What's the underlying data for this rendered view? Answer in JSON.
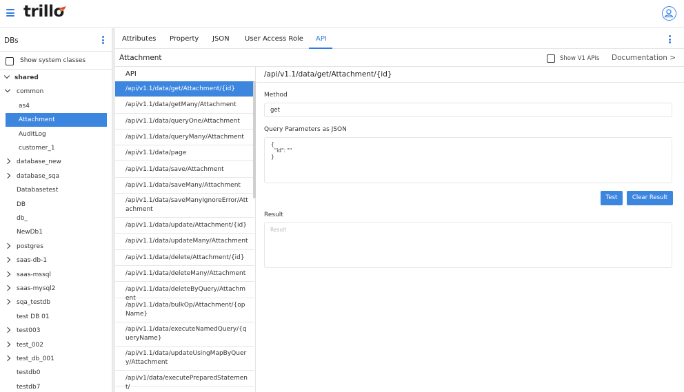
{
  "app": {
    "logo_text": "trillo",
    "accent": "#2f7be0",
    "selected_bg": "#3d86e0"
  },
  "topbar": {
    "menu_icon": "hamburger-icon",
    "user_icon": "user-avatar-icon"
  },
  "sidebar": {
    "title": "DBs",
    "show_system_classes_label": "Show system classes",
    "items": [
      {
        "label": "shared",
        "chevron": "down",
        "level": 0
      },
      {
        "label": "common",
        "chevron": "down",
        "level": 1
      },
      {
        "label": "as4",
        "chevron": "",
        "level": 2
      },
      {
        "label": "Attachment",
        "chevron": "",
        "level": 2
      },
      {
        "label": "AuditLog",
        "chevron": "",
        "level": 2
      },
      {
        "label": "customer_1",
        "chevron": "",
        "level": 2
      },
      {
        "label": "database_new",
        "chevron": "right",
        "level": 1
      },
      {
        "label": "database_sqa",
        "chevron": "right",
        "level": 1
      },
      {
        "label": "Databasetest",
        "chevron": "",
        "level": 1
      },
      {
        "label": "DB",
        "chevron": "",
        "level": 1
      },
      {
        "label": "db_",
        "chevron": "",
        "level": 1
      },
      {
        "label": "NewDb1",
        "chevron": "",
        "level": 1
      },
      {
        "label": "postgres",
        "chevron": "right",
        "level": 1
      },
      {
        "label": "saas-db-1",
        "chevron": "right",
        "level": 1
      },
      {
        "label": "saas-mssql",
        "chevron": "right",
        "level": 1
      },
      {
        "label": "saas-mysql2",
        "chevron": "right",
        "level": 1
      },
      {
        "label": "sqa_testdb",
        "chevron": "right",
        "level": 1
      },
      {
        "label": "test DB 01",
        "chevron": "",
        "level": 1
      },
      {
        "label": "test003",
        "chevron": "right",
        "level": 1
      },
      {
        "label": "test_002",
        "chevron": "right",
        "level": 1
      },
      {
        "label": "test_db_001",
        "chevron": "right",
        "level": 1
      },
      {
        "label": "testdb0",
        "chevron": "",
        "level": 1
      },
      {
        "label": "testdb7",
        "chevron": "",
        "level": 1
      }
    ]
  },
  "tabs": [
    {
      "label": "Attributes"
    },
    {
      "label": "Property"
    },
    {
      "label": "JSON"
    },
    {
      "label": "User Access Role"
    },
    {
      "label": "API"
    }
  ],
  "subheader": {
    "title": "Attachment",
    "show_v1_label": "Show V1 APIs",
    "documentation_label": "Documentation >"
  },
  "api_list": {
    "header": "API",
    "items": [
      "/api/v1.1/data/get/Attachment/{id}",
      "/api/v1.1/data/getMany/Attachment",
      "/api/v1.1/data/queryOne/Attachment",
      "/api/v1.1/data/queryMany/Attachment",
      "/api/v1.1/data/page",
      "/api/v1.1/data/save/Attachment",
      "/api/v1.1/data/saveMany/Attachment",
      "/api/v1.1/data/saveManyIgnoreError/Attachment",
      "/api/v1.1/data/update/Attachment/{id}",
      "/api/v1.1/data/updateMany/Attachment",
      "/api/v1.1/data/delete/Attachment/{id}",
      "/api/v1.1/data/deleteMany/Attachment",
      "/api/v1.1/data/deleteByQuery/Attachment",
      "/api/v1.1/data/bulkOp/Attachment/{opName}",
      "/api/v1.1/data/executeNamedQuery/{queryName}",
      "/api/v1.1/data/updateUsingMapByQuery/Attachment",
      "/api/v1/data/executePreparedStatement/"
    ]
  },
  "detail": {
    "title": "/api/v1.1/data/get/Attachment/{id}",
    "method_label": "Method",
    "method_value": "get",
    "query_label": "Query Parameters as JSON",
    "query_value": "{\n  \"id\": \"\"\n}",
    "test_button": "Test",
    "clear_button": "Clear Result",
    "result_label": "Result",
    "result_placeholder": "Result"
  }
}
